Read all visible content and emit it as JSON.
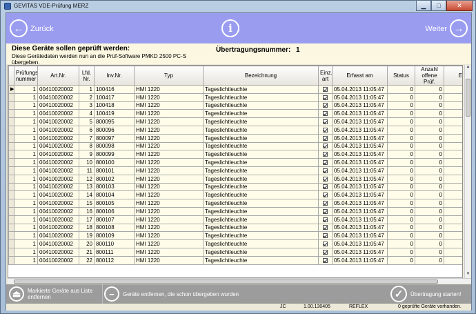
{
  "window": {
    "title": "GEVITAS VDE-Prüfung MERZ"
  },
  "nav": {
    "back_label": "Zurück",
    "next_label": "Weiter"
  },
  "header": {
    "title": "Diese Geräte sollen geprüft werden:",
    "subtitle": "Diese Gerätedaten werden nun an die Prüf-Software PMKD 2500 PC-S übergeben.",
    "transfer_label": "Übertragungsnummer:",
    "transfer_number": "1"
  },
  "grid": {
    "columns": [
      "Prüfungs nummer",
      "Art.Nr.",
      "Lfd. Nr.",
      "Inv.Nr.",
      "Typ",
      "Bezeichnung",
      "Einz. art",
      "Erfasst am",
      "Status",
      "Anzahl offene Prüf.",
      "Erh.vor a"
    ],
    "rows": [
      {
        "pnr": "1",
        "art": "00410020002",
        "lfd": "1",
        "inv": "100416",
        "typ": "HMI 1220",
        "bez": "Tageslichtleuchte",
        "date": "05.04.2013 11:05:47",
        "status": "0",
        "offen": "0",
        "erh": "0"
      },
      {
        "pnr": "1",
        "art": "00410020002",
        "lfd": "2",
        "inv": "100417",
        "typ": "HMI 1220",
        "bez": "Tageslichtleuchte",
        "date": "05.04.2013 11:05:47",
        "status": "0",
        "offen": "0",
        "erh": "0"
      },
      {
        "pnr": "1",
        "art": "00410020002",
        "lfd": "3",
        "inv": "100418",
        "typ": "HMI 1220",
        "bez": "Tageslichtleuchte",
        "date": "05.04.2013 11:05:47",
        "status": "0",
        "offen": "0",
        "erh": "0"
      },
      {
        "pnr": "1",
        "art": "00410020002",
        "lfd": "4",
        "inv": "100419",
        "typ": "HMI 1220",
        "bez": "Tageslichtleuchte",
        "date": "05.04.2013 11:05:47",
        "status": "0",
        "offen": "0",
        "erh": "0"
      },
      {
        "pnr": "1",
        "art": "00410020002",
        "lfd": "5",
        "inv": "800095",
        "typ": "HMI 1220",
        "bez": "Tageslichtleuchte",
        "date": "05.04.2013 11:05:47",
        "status": "0",
        "offen": "0",
        "erh": "0"
      },
      {
        "pnr": "1",
        "art": "00410020002",
        "lfd": "6",
        "inv": "800096",
        "typ": "HMI 1220",
        "bez": "Tageslichtleuchte",
        "date": "05.04.2013 11:05:47",
        "status": "0",
        "offen": "0",
        "erh": "0"
      },
      {
        "pnr": "1",
        "art": "00410020002",
        "lfd": "7",
        "inv": "800097",
        "typ": "HMI 1220",
        "bez": "Tageslichtleuchte",
        "date": "05.04.2013 11:05:47",
        "status": "0",
        "offen": "0",
        "erh": "0"
      },
      {
        "pnr": "1",
        "art": "00410020002",
        "lfd": "8",
        "inv": "800098",
        "typ": "HMI 1220",
        "bez": "Tageslichtleuchte",
        "date": "05.04.2013 11:05:47",
        "status": "0",
        "offen": "0",
        "erh": "0"
      },
      {
        "pnr": "1",
        "art": "00410020002",
        "lfd": "9",
        "inv": "800099",
        "typ": "HMI 1220",
        "bez": "Tageslichtleuchte",
        "date": "05.04.2013 11:05:47",
        "status": "0",
        "offen": "0",
        "erh": "0"
      },
      {
        "pnr": "1",
        "art": "00410020002",
        "lfd": "10",
        "inv": "800100",
        "typ": "HMI 1220",
        "bez": "Tageslichtleuchte",
        "date": "05.04.2013 11:05:47",
        "status": "0",
        "offen": "0",
        "erh": "0"
      },
      {
        "pnr": "1",
        "art": "00410020002",
        "lfd": "11",
        "inv": "800101",
        "typ": "HMI 1220",
        "bez": "Tageslichtleuchte",
        "date": "05.04.2013 11:05:47",
        "status": "0",
        "offen": "0",
        "erh": "0"
      },
      {
        "pnr": "1",
        "art": "00410020002",
        "lfd": "12",
        "inv": "800102",
        "typ": "HMI 1220",
        "bez": "Tageslichtleuchte",
        "date": "05.04.2013 11:05:47",
        "status": "0",
        "offen": "0",
        "erh": "0"
      },
      {
        "pnr": "1",
        "art": "00410020002",
        "lfd": "13",
        "inv": "800103",
        "typ": "HMI 1220",
        "bez": "Tageslichtleuchte",
        "date": "05.04.2013 11:05:47",
        "status": "0",
        "offen": "0",
        "erh": "0"
      },
      {
        "pnr": "1",
        "art": "00410020002",
        "lfd": "14",
        "inv": "800104",
        "typ": "HMI 1220",
        "bez": "Tageslichtleuchte",
        "date": "05.04.2013 11:05:47",
        "status": "0",
        "offen": "0",
        "erh": "0"
      },
      {
        "pnr": "1",
        "art": "00410020002",
        "lfd": "15",
        "inv": "800105",
        "typ": "HMI 1220",
        "bez": "Tageslichtleuchte",
        "date": "05.04.2013 11:05:47",
        "status": "0",
        "offen": "0",
        "erh": "0"
      },
      {
        "pnr": "1",
        "art": "00410020002",
        "lfd": "16",
        "inv": "800106",
        "typ": "HMI 1220",
        "bez": "Tageslichtleuchte",
        "date": "05.04.2013 11:05:47",
        "status": "0",
        "offen": "0",
        "erh": "0"
      },
      {
        "pnr": "1",
        "art": "00410020002",
        "lfd": "17",
        "inv": "800107",
        "typ": "HMI 1220",
        "bez": "Tageslichtleuchte",
        "date": "05.04.2013 11:05:47",
        "status": "0",
        "offen": "0",
        "erh": "0"
      },
      {
        "pnr": "1",
        "art": "00410020002",
        "lfd": "18",
        "inv": "800108",
        "typ": "HMI 1220",
        "bez": "Tageslichtleuchte",
        "date": "05.04.2013 11:05:47",
        "status": "0",
        "offen": "0",
        "erh": "0"
      },
      {
        "pnr": "1",
        "art": "00410020002",
        "lfd": "19",
        "inv": "800109",
        "typ": "HMI 1220",
        "bez": "Tageslichtleuchte",
        "date": "05.04.2013 11:05:47",
        "status": "0",
        "offen": "0",
        "erh": "0"
      },
      {
        "pnr": "1",
        "art": "00410020002",
        "lfd": "20",
        "inv": "800110",
        "typ": "HMI 1220",
        "bez": "Tageslichtleuchte",
        "date": "05.04.2013 11:05:47",
        "status": "0",
        "offen": "0",
        "erh": "0"
      },
      {
        "pnr": "1",
        "art": "00410020002",
        "lfd": "21",
        "inv": "800111",
        "typ": "HMI 1220",
        "bez": "Tageslichtleuchte",
        "date": "05.04.2013 11:05:47",
        "status": "0",
        "offen": "0",
        "erh": "0"
      },
      {
        "pnr": "1",
        "art": "00410020002",
        "lfd": "22",
        "inv": "800112",
        "typ": "HMI 1220",
        "bez": "Tageslichtleuchte",
        "date": "05.04.2013 11:05:47",
        "status": "0",
        "offen": "0",
        "erh": "0"
      }
    ]
  },
  "footer": {
    "remove_marked": "Markierte Geräte aus Liste entfernen",
    "remove_tested": "Geräte entfernen, die schon übergeben wurden",
    "start_transfer": "Übertragung starten!"
  },
  "status": {
    "user": "JC",
    "version": "1.00.130405",
    "company": "REFLEX",
    "count_text": "0 geprüfte Geräte vorhanden."
  },
  "colors": {
    "nav_bg": "#9a9cf0",
    "footer_bg": "#9c9c9c",
    "header_bg": "#fbf7e1"
  }
}
